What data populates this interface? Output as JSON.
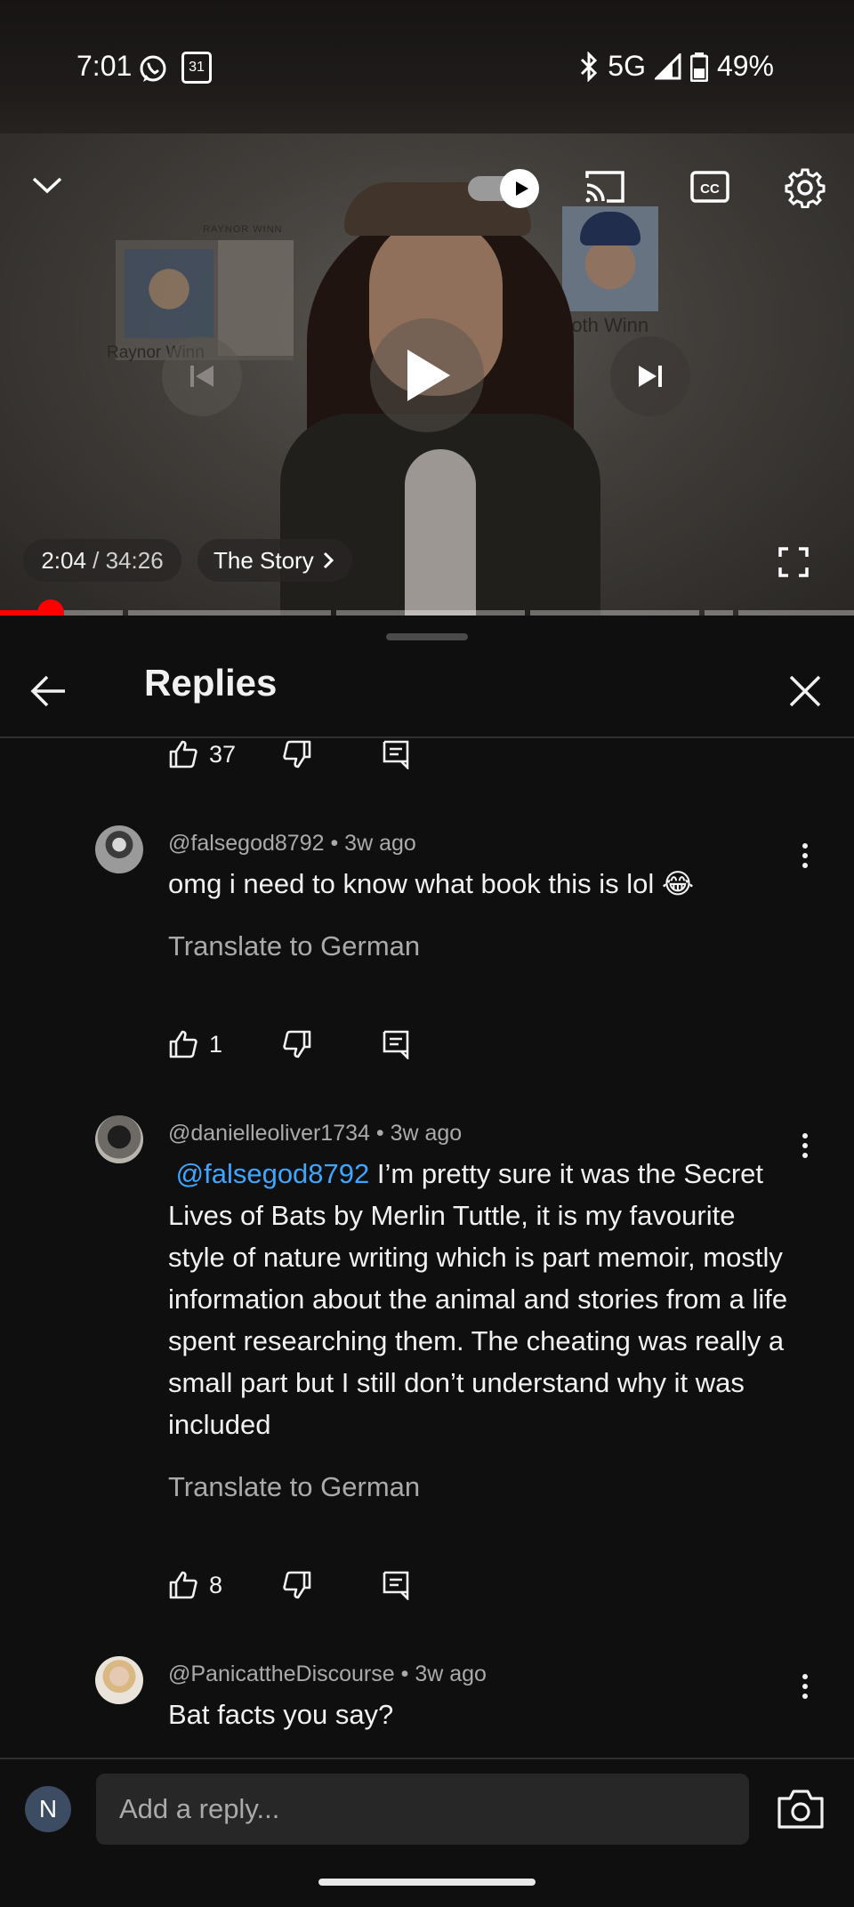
{
  "status_bar": {
    "time": "7:01",
    "calendar_day": "31",
    "network": "5G",
    "battery": "49%"
  },
  "video": {
    "poster_left_caption": "Raynor Winn",
    "poster_top_caption": "RAYNOR WINN",
    "poster_right_caption": "Moth Winn",
    "current_time": "2:04",
    "duration": "34:26",
    "time_separator": " / ",
    "chapter": "The Story",
    "progress_fraction": 0.0595
  },
  "panel": {
    "title": "Replies"
  },
  "comments": [
    {
      "likes": "37"
    },
    {
      "handle": "@falsegod8792",
      "age": "3w ago",
      "text": "omg i need to know what book this is lol 😂",
      "translate": "Translate to German",
      "likes": "1"
    },
    {
      "handle": "@danielleoliver1734",
      "age": "3w ago",
      "mention": "@falsegod8792",
      "text": " I’m pretty sure it was the Secret Lives of Bats by Merlin Tuttle, it is my favourite style of nature writing which is part memoir, mostly information about the animal and stories from a life spent researching them. The cheating was really a small part but I still don’t understand why it was included",
      "translate": "Translate to German",
      "likes": "8"
    },
    {
      "handle": "@PanicattheDiscourse",
      "age": "3w ago",
      "text": "Bat facts you say?"
    }
  ],
  "composer": {
    "avatar_initial": "N",
    "placeholder": "Add a reply..."
  },
  "colors": {
    "accent_red": "#ff0000",
    "mention_blue": "#3ea6ff",
    "background": "#0f0f0f"
  }
}
